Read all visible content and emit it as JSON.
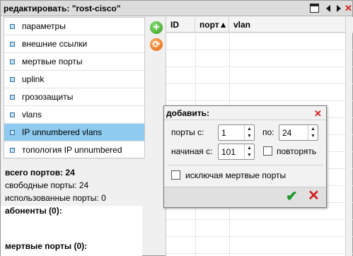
{
  "window": {
    "title": "редактировать: \"rost-cisco\"",
    "icons": [
      "maximize-icon",
      "arrow-left-icon",
      "arrow-right-icon",
      "close-icon"
    ]
  },
  "sidebar": {
    "items": [
      {
        "label": "параметры",
        "selected": false
      },
      {
        "label": "внешние ссылки",
        "selected": false
      },
      {
        "label": "мертвые порты",
        "selected": false
      },
      {
        "label": "uplink",
        "selected": false
      },
      {
        "label": "грозозащиты",
        "selected": false
      },
      {
        "label": "vlans",
        "selected": false
      },
      {
        "label": "IP unnumbered vlans",
        "selected": true
      },
      {
        "label": "топология IP unnumbered",
        "selected": false
      }
    ]
  },
  "stats": {
    "total_ports": "всего портов: 24",
    "free_ports": "свободные порты: 24",
    "used_ports": "использованные порты: 0",
    "subscribers": "абоненты (0):",
    "dead_ports": "мертвые порты (0):"
  },
  "grid": {
    "columns": [
      "ID",
      "порт▲",
      "vlan"
    ],
    "rows": []
  },
  "dialog": {
    "title": "добавить:",
    "ports_from_label": "порты с:",
    "ports_from_value": "1",
    "ports_to_label": "по:",
    "ports_to_value": "24",
    "start_from_label": "начиная с:",
    "start_from_value": "101",
    "repeat_label": "повторять",
    "exclude_dead_label": "исключая мертвые порты"
  },
  "colors": {
    "selected_bg": "#8fcbf1",
    "title_bg": "#dcdcdc",
    "ok_green": "#1c9a2a",
    "close_red": "#d21f1f"
  }
}
